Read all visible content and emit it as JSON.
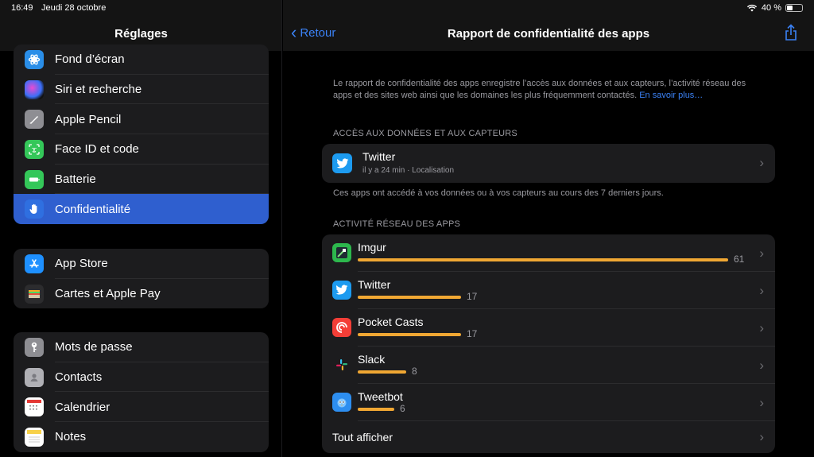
{
  "status_bar": {
    "time": "16:49",
    "date": "Jeudi 28 octobre",
    "battery": "40 %",
    "battery_level": 0.4
  },
  "sidebar": {
    "title": "Réglages",
    "group1": [
      {
        "label": "Fond d’écran",
        "icon": "wallpaper-icon",
        "color": "#2a8ee8"
      },
      {
        "label": "Siri et recherche",
        "icon": "siri-icon",
        "color": "#1a1a2e"
      },
      {
        "label": "Apple Pencil",
        "icon": "pencil-icon",
        "color": "#8e8e93"
      },
      {
        "label": "Face ID et code",
        "icon": "faceid-icon",
        "color": "#34c759"
      },
      {
        "label": "Batterie",
        "icon": "battery-icon",
        "color": "#34c759"
      },
      {
        "label": "Confidentialité",
        "icon": "hand-icon",
        "color": "#2f6fe0",
        "selected": true
      }
    ],
    "group2": [
      {
        "label": "App Store",
        "icon": "appstore-icon",
        "color": "#1e90ff"
      },
      {
        "label": "Cartes et Apple Pay",
        "icon": "wallet-icon",
        "color": "#1c1c1e"
      }
    ],
    "group3": [
      {
        "label": "Mots de passe",
        "icon": "key-icon",
        "color": "#8e8e93"
      },
      {
        "label": "Contacts",
        "icon": "contacts-icon",
        "color": "#b0b0b5"
      },
      {
        "label": "Calendrier",
        "icon": "calendar-icon",
        "color": "#ffffff"
      },
      {
        "label": "Notes",
        "icon": "notes-icon",
        "color": "#f7d14a"
      }
    ]
  },
  "main": {
    "back_label": "Retour",
    "title": "Rapport de confidentialité des apps",
    "intro": "Le rapport de confidentialité des apps enregistre l’accès aux données et aux capteurs, l’activité réseau des apps et des sites web ainsi que les domaines les plus fréquemment contactés.",
    "intro_link": "En savoir plus…",
    "access_header": "ACCÈS AUX DONNÉES ET AUX CAPTEURS",
    "access_item": {
      "name": "Twitter",
      "detail": "il y a 24 min · Localisation"
    },
    "access_footnote": "Ces apps ont accédé à vos données ou à vos capteurs au cours des 7 derniers jours.",
    "network_header": "ACTIVITÉ RÉSEAU DES APPS",
    "network": [
      {
        "name": "Imgur",
        "count": "61",
        "value": 61,
        "icon": "imgur-icon",
        "color": "#2db84d"
      },
      {
        "name": "Twitter",
        "count": "17",
        "value": 17,
        "icon": "twitter-icon",
        "color": "#1d9bf0"
      },
      {
        "name": "Pocket Casts",
        "count": "17",
        "value": 17,
        "icon": "pocketcasts-icon",
        "color": "#f43e37"
      },
      {
        "name": "Slack",
        "count": "8",
        "value": 8,
        "icon": "slack-icon",
        "color": "#1c1c1e"
      },
      {
        "name": "Tweetbot",
        "count": "6",
        "value": 6,
        "icon": "tweetbot-icon",
        "color": "#2d8ef0"
      }
    ],
    "show_all": "Tout afficher"
  }
}
